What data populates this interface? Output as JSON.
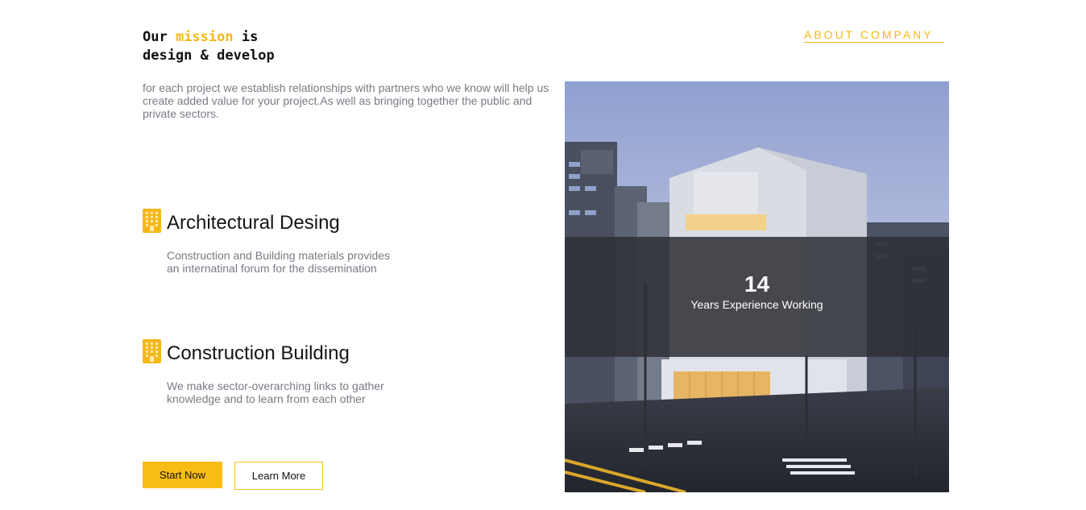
{
  "heading": {
    "line1_pre": "Our ",
    "line1_accent": "mission",
    "line1_post": " is",
    "line2": "design & develop"
  },
  "about_link": "ABOUT COMPANY",
  "intro": "for each project we establish relationships with partners who we know will help us create added value for your project.As well as bringing together the public and private sectors.",
  "features": [
    {
      "icon": "building-icon",
      "title": "Architectural Desing",
      "description_line1": "Construction and Building materials provides",
      "description_line2": "an internatinal forum for the dissemination"
    },
    {
      "icon": "building-icon",
      "title": "Construction Building",
      "description_line1": "We make sector-overarching links to gather",
      "description_line2": "knowledge and to learn from each other"
    }
  ],
  "buttons": {
    "start": "Start Now",
    "learn": "Learn More"
  },
  "stat": {
    "number": "14",
    "label": "Years Experience Working"
  },
  "colors": {
    "accent": "#f6b719",
    "text_dark": "#111111",
    "text_muted": "#7a7a85",
    "overlay": "#2d3036"
  }
}
